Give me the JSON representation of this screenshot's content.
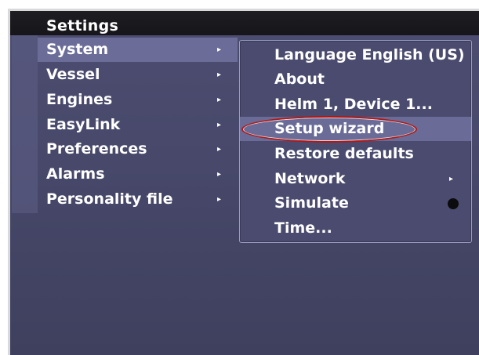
{
  "window": {
    "title": "Settings"
  },
  "left_menu": {
    "items": [
      {
        "label": "System",
        "arrow": "▸",
        "selected": true
      },
      {
        "label": "Vessel",
        "arrow": "▸"
      },
      {
        "label": "Engines",
        "arrow": "▸"
      },
      {
        "label": "EasyLink",
        "arrow": "▸"
      },
      {
        "label": "Preferences",
        "arrow": "▸"
      },
      {
        "label": "Alarms",
        "arrow": "▸"
      },
      {
        "label": "Personality file",
        "arrow": "▸"
      }
    ]
  },
  "submenu": {
    "items": [
      {
        "label": "Language English (US)"
      },
      {
        "label": "About"
      },
      {
        "label": "Helm 1, Device 1..."
      },
      {
        "label": "Setup wizard",
        "highlighted": true
      },
      {
        "label": "Restore defaults"
      },
      {
        "label": "Network",
        "arrow": "▸"
      },
      {
        "label": "Simulate",
        "toggle": "off"
      },
      {
        "label": "Time..."
      }
    ]
  },
  "colors": {
    "background": "#47486a",
    "title_bar": "#17171b",
    "selection": "#6b6d98",
    "annotation_ring": "#b01818"
  },
  "icons": {
    "submenu_arrow": "chevron-right-icon",
    "toggle": "radio-dot-icon"
  }
}
